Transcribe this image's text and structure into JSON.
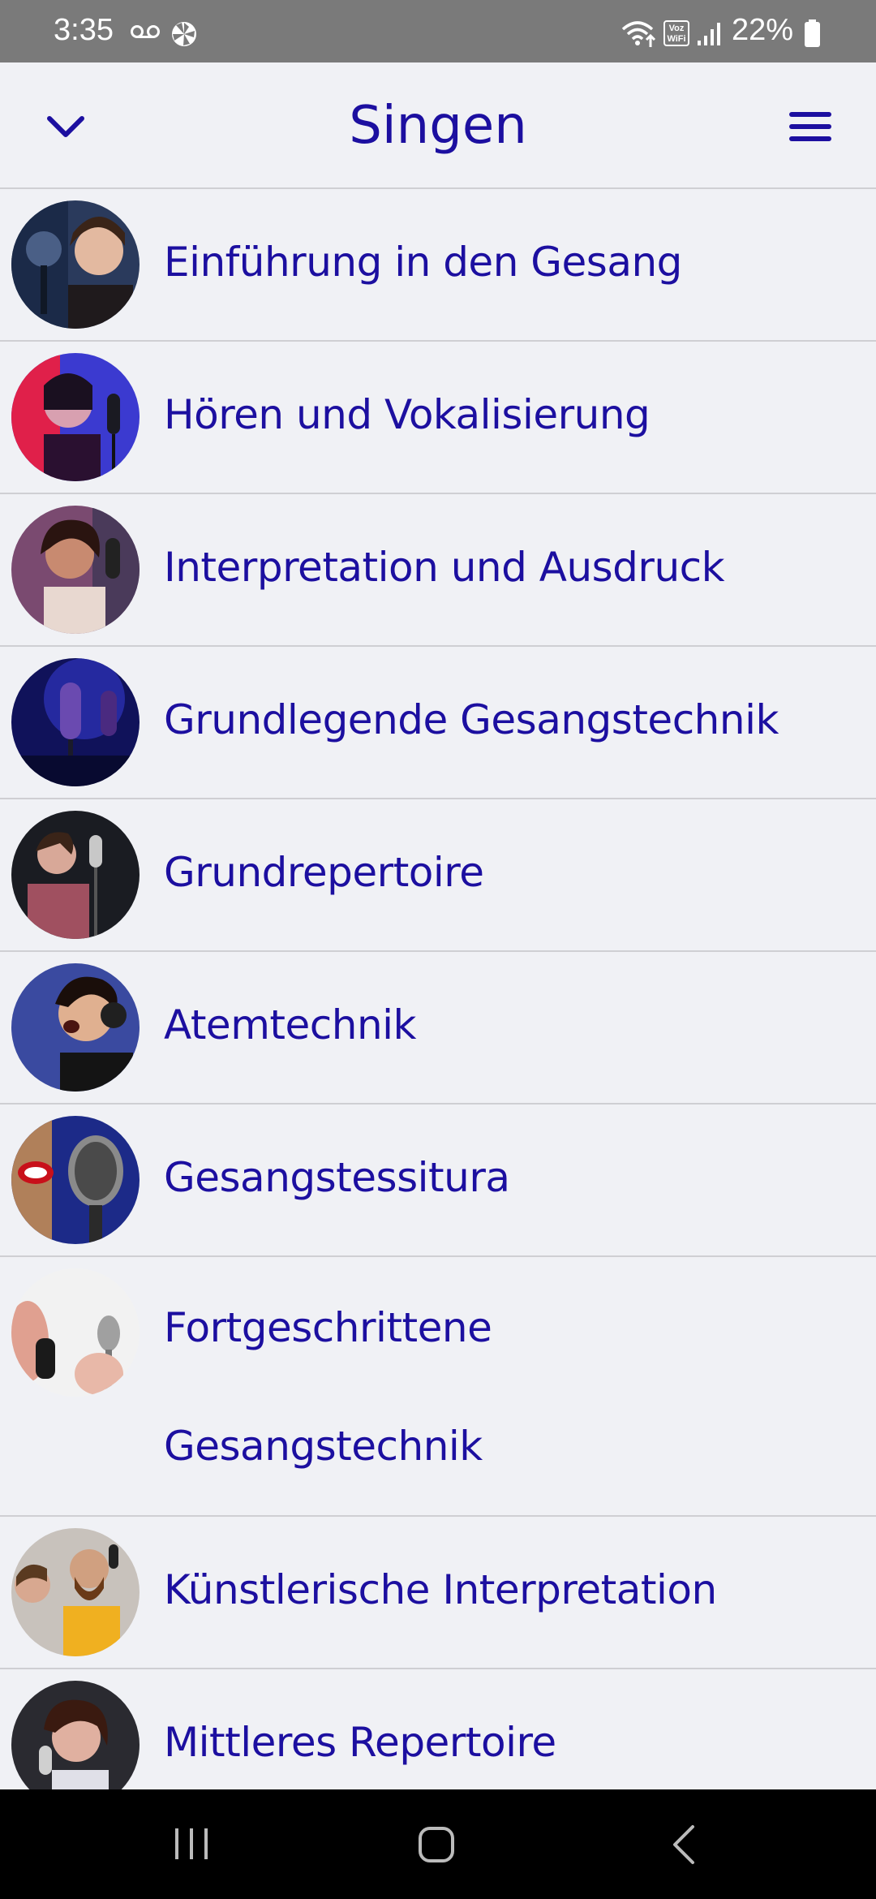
{
  "status_bar": {
    "time": "3:35",
    "volte_label": "Voz WiFi",
    "battery": "22%"
  },
  "header": {
    "title": "Singen",
    "collapse_icon": "chevron-down-icon",
    "menu_icon": "hamburger-menu-icon"
  },
  "topics": [
    {
      "label": "Einführung in den Gesang"
    },
    {
      "label": "Hören und Vokalisierung"
    },
    {
      "label": "Interpretation und Ausdruck"
    },
    {
      "label": "Grundlegende Gesangstechnik"
    },
    {
      "label": "Grundrepertoire"
    },
    {
      "label": "Atemtechnik"
    },
    {
      "label": "Gesangstessitura"
    },
    {
      "label_line1": "Fortgeschrittene",
      "label_line2": "Gesangstechnik"
    },
    {
      "label": "Künstlerische Interpretation"
    },
    {
      "label": "Mittleres Repertoire"
    }
  ],
  "nav_bar": {
    "recents_icon": "recents-icon",
    "home_icon": "home-icon",
    "back_icon": "back-icon"
  },
  "colors": {
    "accent": "#1c0fa0",
    "background": "#f0f1f5",
    "status_bar": "#7a7a7a",
    "nav_bar": "#000000",
    "divider": "#cfcfd3"
  }
}
